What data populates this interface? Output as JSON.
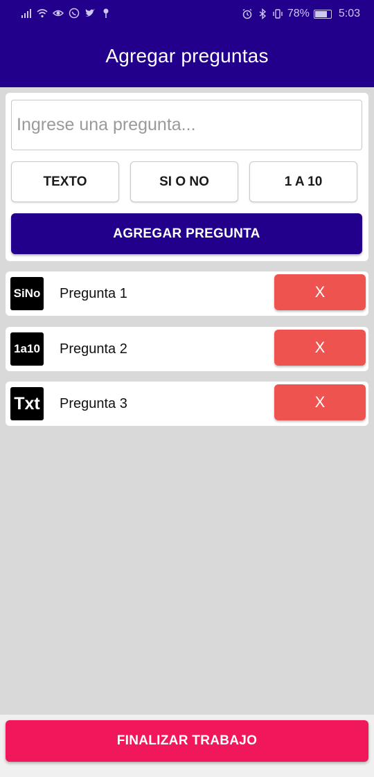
{
  "status_bar": {
    "left_icons": [
      "signal-icon",
      "wifi-icon",
      "eye-icon",
      "whatsapp-icon",
      "twitter-icon",
      "pin-icon"
    ],
    "right_icons": [
      "alarm-icon",
      "bluetooth-icon",
      "vibrate-icon"
    ],
    "battery_percent": "78%",
    "battery_level": 0.78,
    "time": "5:03"
  },
  "app_bar": {
    "title": "Agregar preguntas"
  },
  "form": {
    "input": {
      "value": "",
      "placeholder": "Ingrese una pregunta..."
    },
    "type_buttons": [
      {
        "label": "TEXTO"
      },
      {
        "label": "SI O NO"
      },
      {
        "label": "1 A 10"
      }
    ],
    "add_button": "AGREGAR PREGUNTA"
  },
  "questions": [
    {
      "icon_text": "SiNo",
      "label": "Pregunta 1",
      "delete_label": "X"
    },
    {
      "icon_text": "1a10",
      "label": "Pregunta 2",
      "delete_label": "X"
    },
    {
      "icon_text": "Txt",
      "label": "Pregunta 3",
      "delete_label": "X"
    }
  ],
  "footer": {
    "finish_button": "FINALIZAR TRABAJO"
  },
  "colors": {
    "primary": "#22008c",
    "delete": "#ef5350",
    "finish": "#f0185a",
    "background": "#d9d9d9"
  }
}
